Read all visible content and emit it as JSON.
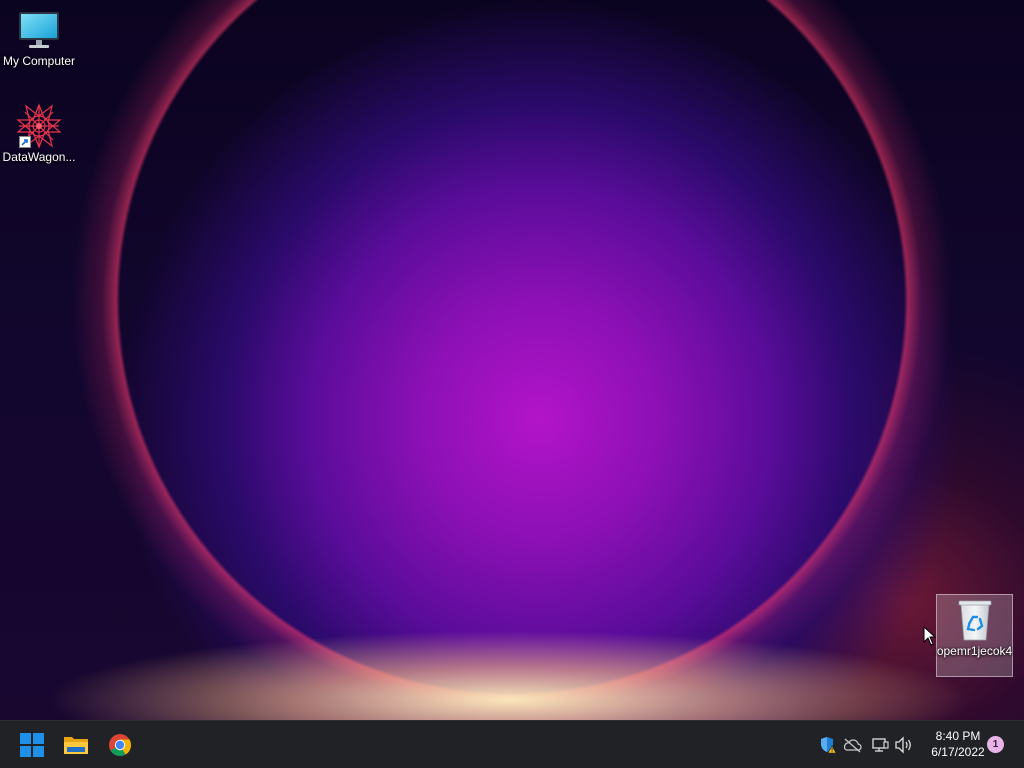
{
  "desktop": {
    "icons": [
      {
        "label": "My Computer",
        "icon": "computer-monitor-icon"
      },
      {
        "label": "DataWagon...",
        "icon": "datawagon-app-icon",
        "shortcut": true
      },
      {
        "label": "opemr1jecok4",
        "icon": "recycle-bin-icon",
        "selected": true
      }
    ]
  },
  "taskbar": {
    "pinned": [
      {
        "name": "Start",
        "icon": "windows-start-icon"
      },
      {
        "name": "File Explorer",
        "icon": "folder-icon"
      },
      {
        "name": "Google Chrome",
        "icon": "chrome-icon"
      }
    ],
    "tray": {
      "icons": [
        "security-shield-warning-icon",
        "onedrive-offline-icon",
        "network-icon",
        "volume-icon"
      ],
      "time": "8:40 PM",
      "date": "6/17/2022",
      "notification_count": "1"
    }
  },
  "colors": {
    "taskbar_bg": "#202226",
    "selection_bg": "rgba(255,255,255,0.22)",
    "badge": "#e8b4e8",
    "windows_blue": "#1e90e8"
  }
}
